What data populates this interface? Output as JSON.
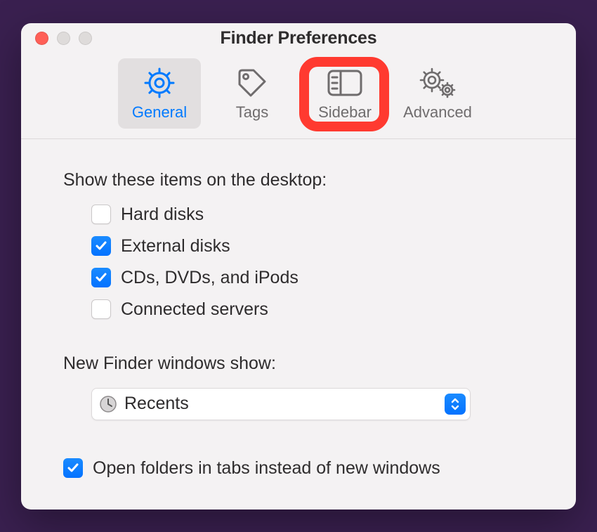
{
  "window": {
    "title": "Finder Preferences"
  },
  "tabs": [
    {
      "id": "general",
      "label": "General",
      "selected": true,
      "highlighted": false
    },
    {
      "id": "tags",
      "label": "Tags",
      "selected": false,
      "highlighted": false
    },
    {
      "id": "sidebar",
      "label": "Sidebar",
      "selected": false,
      "highlighted": true
    },
    {
      "id": "advanced",
      "label": "Advanced",
      "selected": false,
      "highlighted": false
    }
  ],
  "section1": {
    "heading": "Show these items on the desktop:",
    "checkboxes": [
      {
        "id": "hard-disks",
        "label": "Hard disks",
        "checked": false
      },
      {
        "id": "external-disks",
        "label": "External disks",
        "checked": true
      },
      {
        "id": "cds-dvds-ipods",
        "label": "CDs, DVDs, and iPods",
        "checked": true
      },
      {
        "id": "connected-servers",
        "label": "Connected servers",
        "checked": false
      }
    ]
  },
  "section2": {
    "heading": "New Finder windows show:",
    "select_value": "Recents"
  },
  "bottom_checkbox": {
    "label": "Open folders in tabs instead of new windows",
    "checked": true
  }
}
